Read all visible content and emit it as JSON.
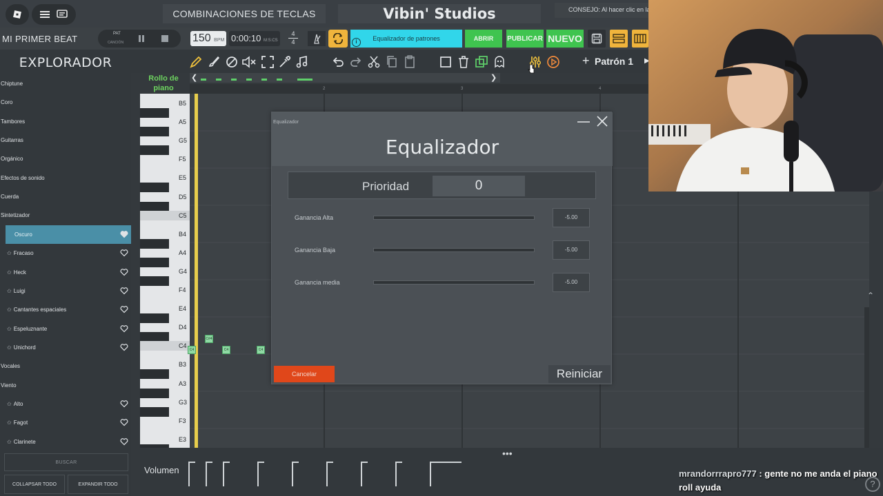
{
  "topbar": {
    "shortcuts_tab": "COMBINACIONES DE TECLAS",
    "studio_title": "Vibin' Studios",
    "tip": "CONSEJO: Al hacer clic en la"
  },
  "transport": {
    "beat_name": "MI PRIMER BEAT",
    "pat_label": "PAT",
    "song_label": "CANCIÓN",
    "bpm": "150",
    "bpm_unit": "BPM",
    "time": "0:00:10",
    "time_unit": "M:S:CS",
    "timesig_top": "4",
    "timesig_bottom": "4",
    "pattern_field": "Equalizador de patrones",
    "open_label": "ABRIR",
    "publish_label": "PUBLICAR",
    "new_label": "NUEVO"
  },
  "explorer": {
    "title": "EXPLORADOR",
    "items": [
      {
        "label": "Chiptune",
        "kind": "cat"
      },
      {
        "label": "Coro",
        "kind": "cat"
      },
      {
        "label": "Tambores",
        "kind": "cat"
      },
      {
        "label": "Guitarras",
        "kind": "cat"
      },
      {
        "label": "Orgánico",
        "kind": "cat"
      },
      {
        "label": "Efectos de sonido",
        "kind": "cat"
      },
      {
        "label": "Cuerda",
        "kind": "cat"
      },
      {
        "label": "Sintetizador",
        "kind": "cat"
      },
      {
        "label": "Oscuro",
        "kind": "sel"
      },
      {
        "label": "Fracaso",
        "kind": "sub"
      },
      {
        "label": "Heck",
        "kind": "sub"
      },
      {
        "label": "Luigi",
        "kind": "sub"
      },
      {
        "label": "Cantantes espaciales",
        "kind": "sub"
      },
      {
        "label": "Espeluznante",
        "kind": "sub"
      },
      {
        "label": "Unichord",
        "kind": "sub"
      },
      {
        "label": "Vocales",
        "kind": "cat"
      },
      {
        "label": "Viento",
        "kind": "cat"
      },
      {
        "label": "Alto",
        "kind": "sub"
      },
      {
        "label": "Fagot",
        "kind": "sub"
      },
      {
        "label": "Clarinete",
        "kind": "sub"
      }
    ],
    "search_label": "BUSCAR",
    "collapse_label": "COLLAPSAR TODO",
    "expand_label": "EXPANDIR TODO"
  },
  "piano_roll": {
    "label_line1": "Rollo de",
    "label_line2": "piano",
    "pattern_name": "Patrón 1",
    "ruler_marks": [
      "2",
      "3",
      "4"
    ],
    "keys": [
      "B5",
      "A5",
      "G5",
      "F5",
      "E5",
      "D5",
      "C5",
      "B4",
      "A4",
      "G4",
      "F4",
      "E4",
      "D4",
      "C4",
      "B3",
      "A3",
      "G3",
      "F3",
      "E3"
    ],
    "notes": [
      "C4",
      "C#4",
      "C4",
      "C4"
    ],
    "volume_label": "Volumen",
    "volume_dots": "•••"
  },
  "equalizer": {
    "window_title": "Equalizador",
    "title": "Equalizador",
    "priority_label": "Prioridad",
    "priority_value": "0",
    "rows": [
      {
        "label": "Ganancia Alta",
        "value": "-5.00"
      },
      {
        "label": "Ganancia Baja",
        "value": "-5.00"
      },
      {
        "label": "Ganancia media",
        "value": "-5.00"
      }
    ],
    "cancel_label": "Cancelar",
    "reset_label": "Reiniciar"
  },
  "chat": {
    "user": "mrandorrrapro777",
    "message": " : gente no me anda el piano roll ayuda"
  },
  "colors": {
    "accent_cyan": "#31d6ea",
    "accent_green": "#3fc44f",
    "accent_orange": "#f0b43c",
    "cancel_red": "#e0471a",
    "selected_item": "#4a8fa7"
  }
}
